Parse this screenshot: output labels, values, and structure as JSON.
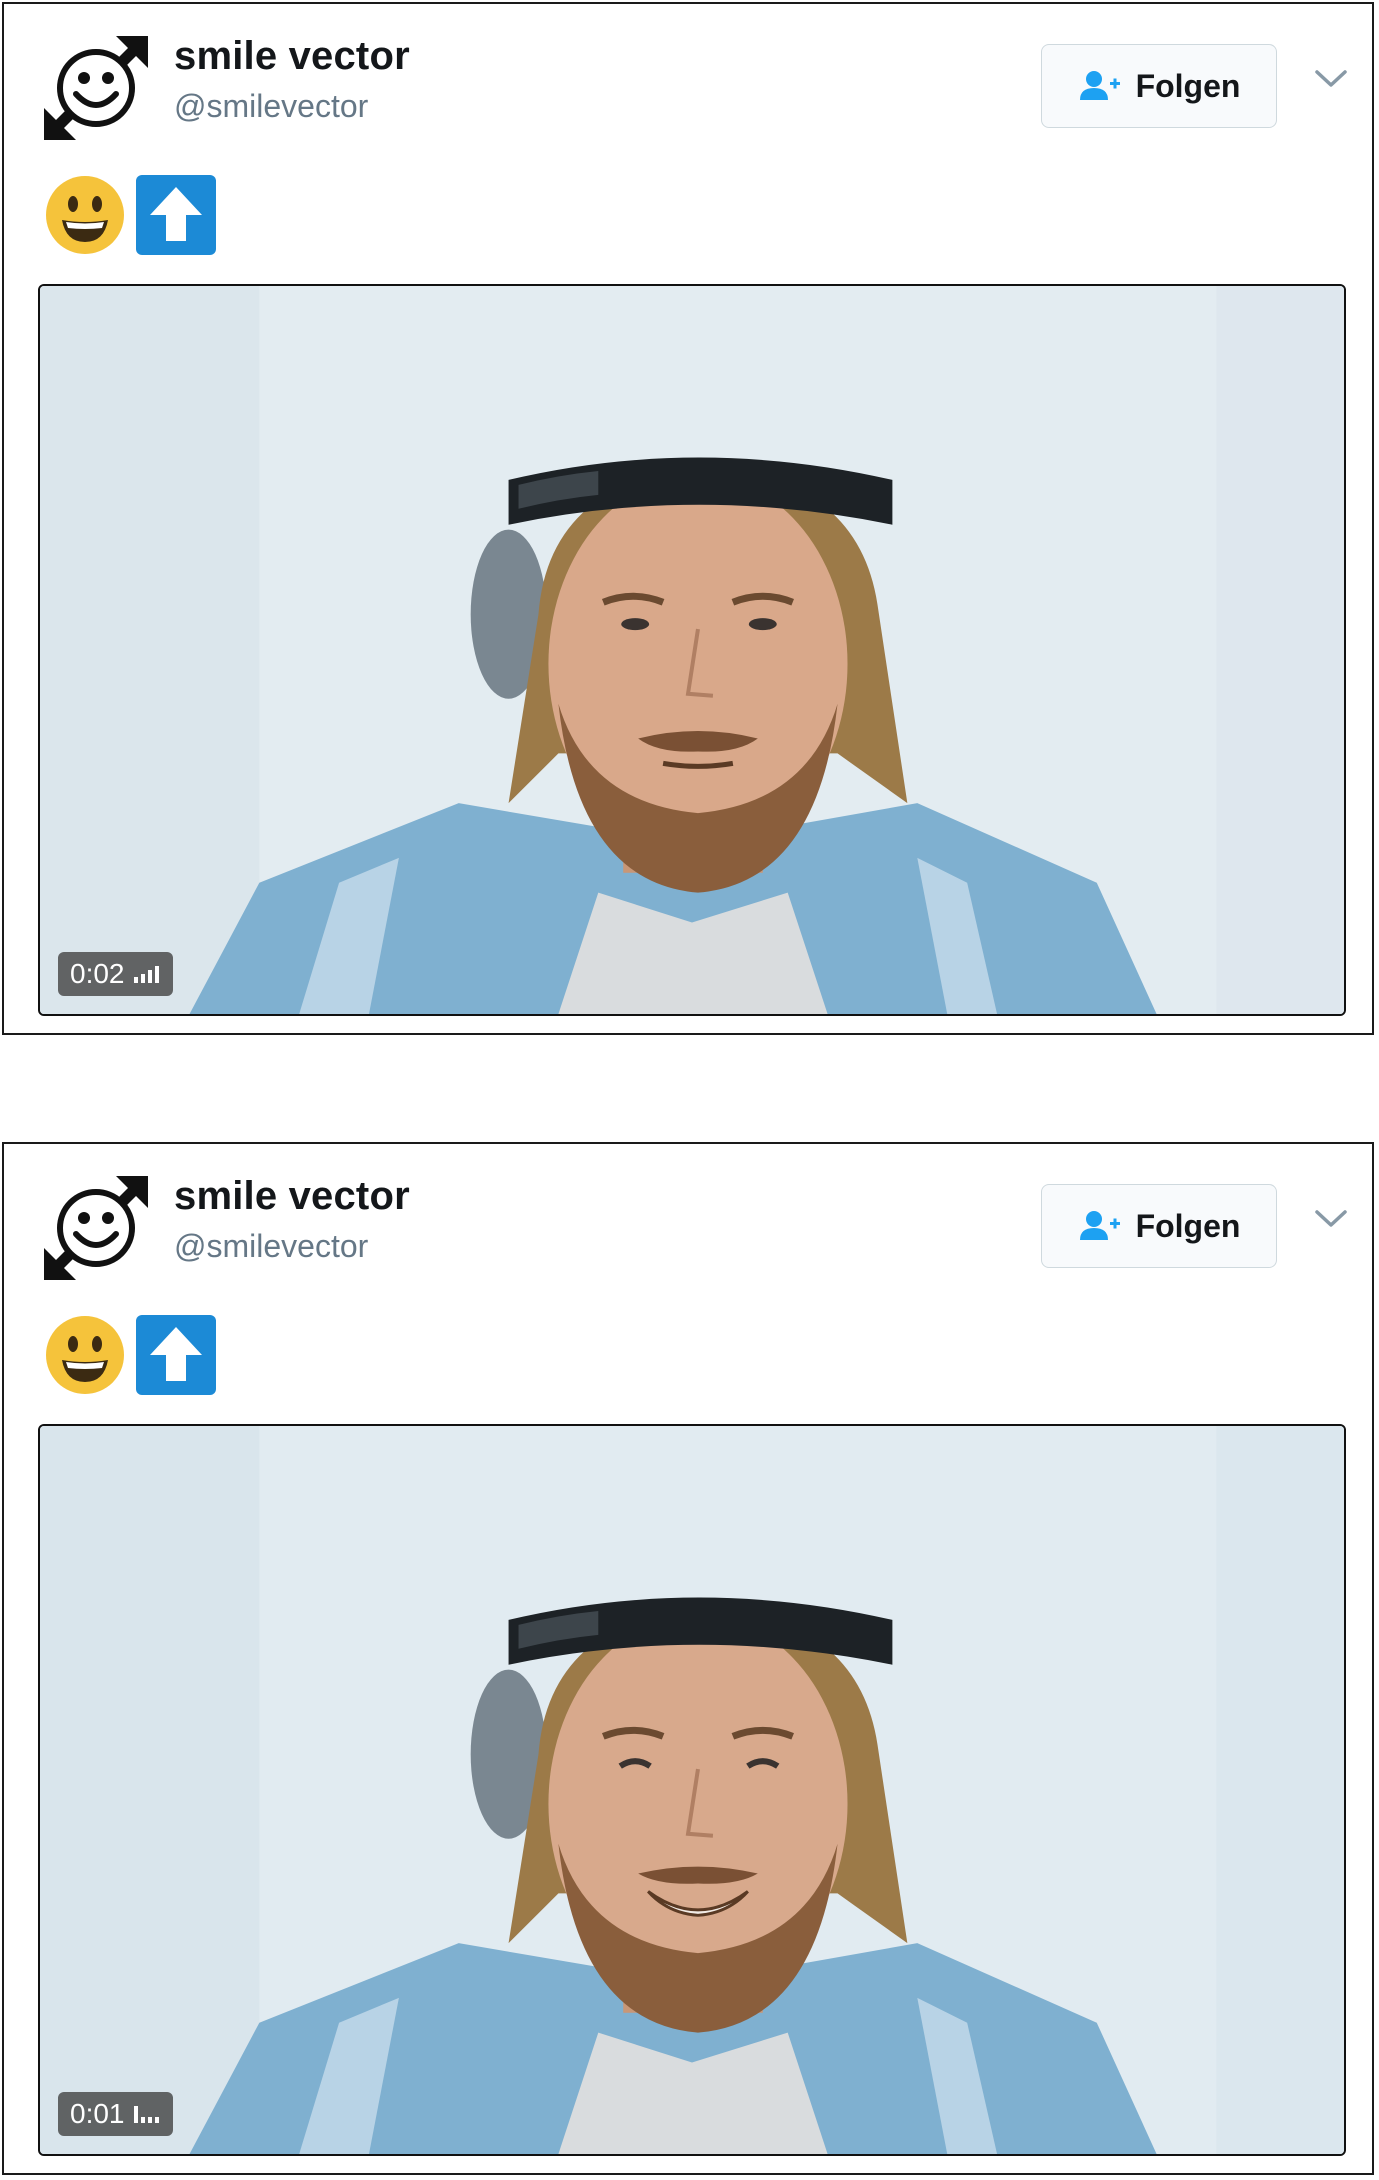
{
  "tweets": [
    {
      "user": {
        "name": "smile vector",
        "handle": "@smilevector"
      },
      "follow_label": "Folgen",
      "emoji": [
        "grinning-face",
        "up-arrow"
      ],
      "video": {
        "duration": "0:02",
        "expression": "neutral"
      }
    },
    {
      "user": {
        "name": "smile vector",
        "handle": "@smilevector"
      },
      "follow_label": "Folgen",
      "emoji": [
        "grinning-face",
        "up-arrow"
      ],
      "video": {
        "duration": "0:01",
        "expression": "smiling"
      }
    }
  ],
  "colors": {
    "accent": "#1da1f2",
    "handle_gray": "#657786",
    "emoji_yellow": "#f5c33b",
    "arrow_blue": "#1c8ad6"
  }
}
